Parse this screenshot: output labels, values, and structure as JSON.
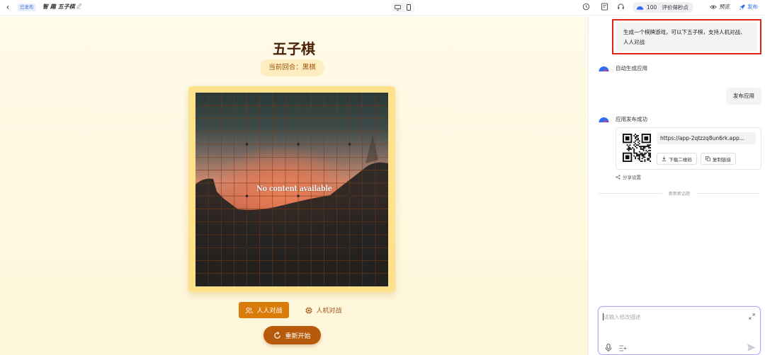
{
  "topbar": {
    "back_icon": "chevron-left-icon",
    "status_badge": "已发布",
    "app_name": "智 趣 五子棋",
    "edit_icon": "pencil-icon",
    "device_modes": [
      "desktop",
      "mobile"
    ],
    "active_device": "mobile",
    "history_icon": "history-icon",
    "doc_icon": "document-icon",
    "support_icon": "headset-icon",
    "credits_count": "100",
    "credits_label": "评价得秒点",
    "preview_label": "预览",
    "publish_label": "发布"
  },
  "game": {
    "title": "五子棋",
    "turn_text": "当前回合：黑棋",
    "board_overlay_text": "No content available",
    "board_size": 15,
    "mode_pvp_label": "人人对战",
    "mode_pve_label": "人机对战",
    "active_mode": "pvp",
    "restart_label": "重新开始"
  },
  "chat": {
    "user_prompt": "生成一个棋牌游戏，可以下五子棋，支持人机对战、人人对战",
    "bot_step_1": "自动生成应用",
    "user_reply": "发布应用",
    "bot_step_2": "应用发布成功",
    "app_url": "https://app-2qtzzq8un6rk.app...",
    "download_qr_label": "下载二维码",
    "copy_link_label": "复制链接",
    "share_settings_label": "分享设置",
    "new_topic_label": "新新新话题",
    "input_placeholder": "请输入修改描述"
  },
  "colors": {
    "accent_orange": "#d97c09",
    "restart_brown": "#b85a0c",
    "title_brown": "#4a2307",
    "highlight_red": "#e2231a",
    "link_blue": "#2d6df6",
    "input_border": "#b7a8f5"
  }
}
